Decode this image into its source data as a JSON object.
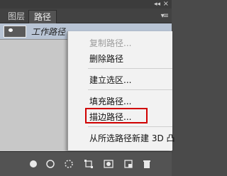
{
  "panel": {
    "collapse_icon": "double-chevron-left-icon",
    "close_icon": "close-icon",
    "tabs": [
      {
        "label": "图层"
      },
      {
        "label": "路径"
      }
    ],
    "menu_icon": "panel-menu-icon"
  },
  "paths": [
    {
      "label": "工作路径"
    }
  ],
  "context_menu": {
    "items": [
      {
        "label": "复制路径...",
        "disabled": true
      },
      {
        "label": "删除路径",
        "disabled": false
      },
      {
        "label": "建立选区...",
        "disabled": false
      },
      {
        "label": "填充路径...",
        "disabled": false
      },
      {
        "label": "描边路径...",
        "disabled": false,
        "highlighted": true
      },
      {
        "label": "从所选路径新建 3D 凸",
        "disabled": false
      }
    ]
  },
  "bottom_icons": [
    "fill-path-icon",
    "stroke-path-icon",
    "load-selection-icon",
    "make-work-path-icon",
    "add-mask-icon",
    "new-path-icon",
    "delete-path-icon"
  ],
  "colors": {
    "highlight": "#d00000",
    "selected_row": "#b8c4d4"
  }
}
